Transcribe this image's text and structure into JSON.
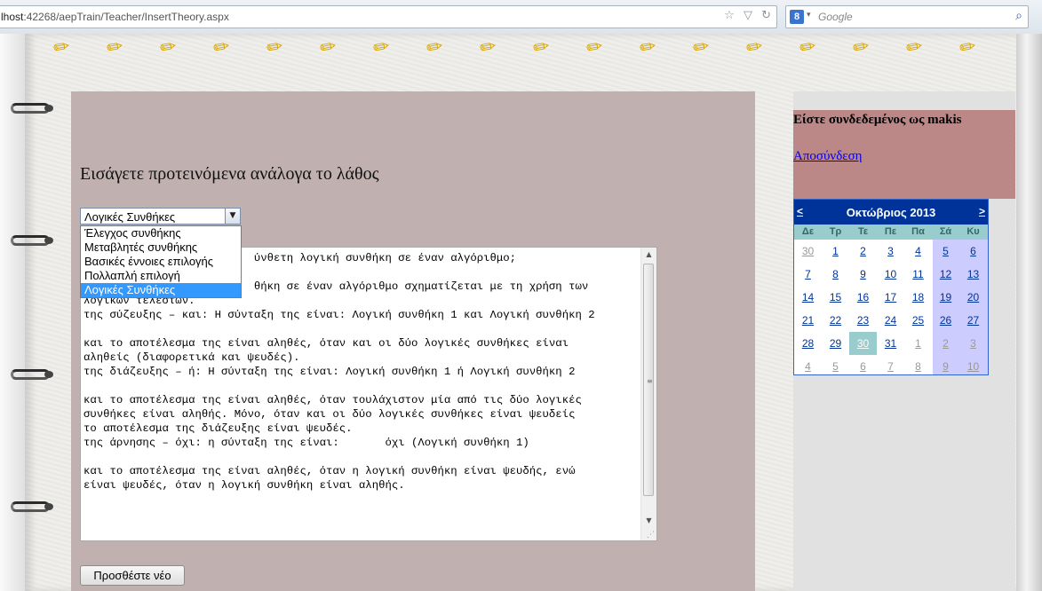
{
  "browser": {
    "url_host": "lhost",
    "url_rest": ":42268/aepTrain/Teacher/InsertTheory.aspx",
    "search_engine_letter": "8",
    "search_placeholder": "Google"
  },
  "main": {
    "heading": "Εισάγετε προτεινόμενα ανάλογα το λάθος",
    "select_value": "Λογικές Συνθήκες",
    "dropdown_options": [
      {
        "label": "Έλεγχος συνθήκης",
        "selected": false
      },
      {
        "label": "Μεταβλητές συνθήκης",
        "selected": false
      },
      {
        "label": "Βασικές έννοιες επιλογής",
        "selected": false
      },
      {
        "label": "Πολλαπλή επιλογή",
        "selected": false
      },
      {
        "label": "Λογικές Συνθήκες",
        "selected": true
      }
    ],
    "textarea_text": "                          ύνθετη λογική συνθήκη σε έναν αλγόριθμο;\n\n                          θήκη σε έναν αλγόριθμο σχηματίζεται με τη χρήση των\nλογικών τελεστών.\nτης σύζευξης – και: Η σύνταξη της είναι: Λογική συνθήκη 1 και Λογική συνθήκη 2\n\nκαι το αποτέλεσμα της είναι αληθές, όταν και οι δύο λογικές συνθήκες είναι\nαληθείς (διαφορετικά και ψευδές).\nτης διάζευξης – ή: Η σύνταξη της είναι: Λογική συνθήκη 1 ή Λογική συνθήκη 2\n\nκαι το αποτέλεσμα της είναι αληθές, όταν τουλάχιστον μία από τις δύο λογικές\nσυνθήκες είναι αληθής. Μόνο, όταν και οι δύο λογικές συνθήκες είναι ψευδείς\nτο αποτέλεσμα της διάζευξης είναι ψευδές.\nτης άρνησης – όχι: η σύνταξη της είναι:       όχι (Λογική συνθήκη 1)\n\nκαι το αποτέλεσμα της είναι αληθές, όταν η λογική συνθήκη είναι ψευδής, ενώ\nείναι ψευδές, όταν η λογική συνθήκη είναι αληθής.",
    "add_button": "Προσθέστε νέο"
  },
  "sidebar": {
    "logged_in_text": "Είστε συνδεδεμένος ως makis",
    "logout_link": "Αποσύνδεση"
  },
  "calendar": {
    "prev": "<",
    "next": ">",
    "month_title": "Οκτώβριος 2013",
    "day_headers": [
      "Δε",
      "Τρ",
      "Τε",
      "Πε",
      "Πα",
      "Σά",
      "Κυ"
    ],
    "weeks": [
      [
        {
          "d": "30",
          "other": true
        },
        {
          "d": "1"
        },
        {
          "d": "2"
        },
        {
          "d": "3"
        },
        {
          "d": "4"
        },
        {
          "d": "5"
        },
        {
          "d": "6"
        }
      ],
      [
        {
          "d": "7"
        },
        {
          "d": "8"
        },
        {
          "d": "9"
        },
        {
          "d": "10"
        },
        {
          "d": "11"
        },
        {
          "d": "12"
        },
        {
          "d": "13"
        }
      ],
      [
        {
          "d": "14"
        },
        {
          "d": "15"
        },
        {
          "d": "16"
        },
        {
          "d": "17"
        },
        {
          "d": "18"
        },
        {
          "d": "19"
        },
        {
          "d": "20"
        }
      ],
      [
        {
          "d": "21"
        },
        {
          "d": "22"
        },
        {
          "d": "23"
        },
        {
          "d": "24"
        },
        {
          "d": "25"
        },
        {
          "d": "26"
        },
        {
          "d": "27"
        }
      ],
      [
        {
          "d": "28"
        },
        {
          "d": "29"
        },
        {
          "d": "30",
          "today": true
        },
        {
          "d": "31"
        },
        {
          "d": "1",
          "other": true
        },
        {
          "d": "2",
          "other": true
        },
        {
          "d": "3",
          "other": true
        }
      ],
      [
        {
          "d": "4",
          "other": true
        },
        {
          "d": "5",
          "other": true
        },
        {
          "d": "6",
          "other": true
        },
        {
          "d": "7",
          "other": true
        },
        {
          "d": "8",
          "other": true
        },
        {
          "d": "9",
          "other": true
        },
        {
          "d": "10",
          "other": true
        }
      ]
    ],
    "colors": {
      "title_bg": "#003399",
      "day_header_bg": "#99cccc",
      "weekend_bg": "#ccccff",
      "today_bg": "#99cccc"
    }
  }
}
